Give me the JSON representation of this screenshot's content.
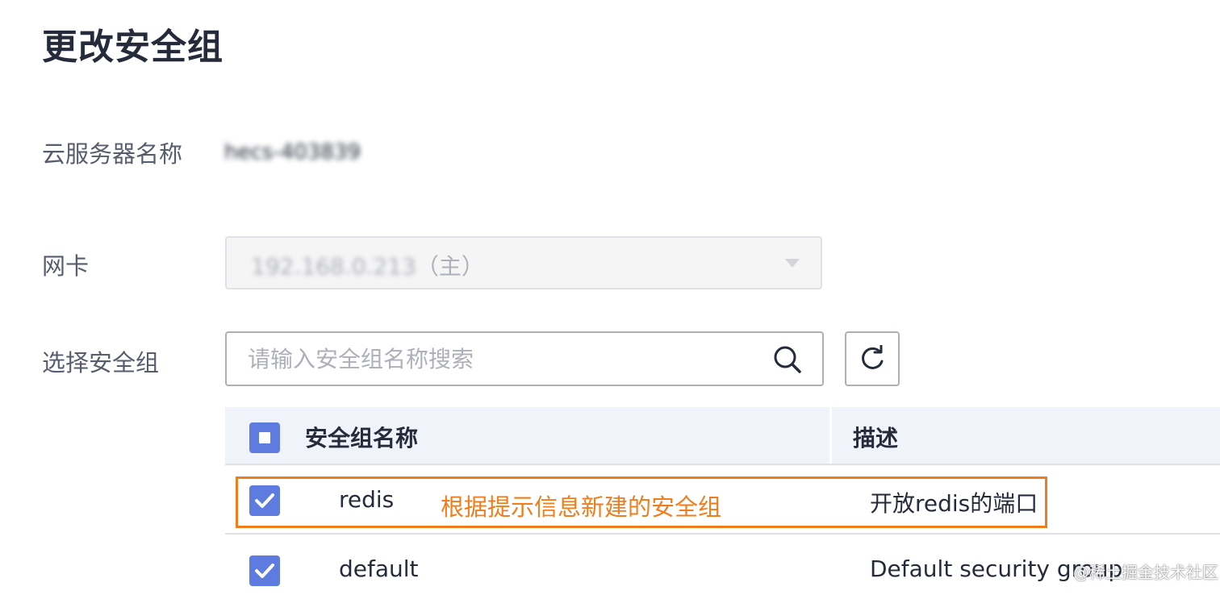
{
  "page": {
    "title": "更改安全组"
  },
  "form": {
    "server_name_label": "云服务器名称",
    "server_name_value": "hecs-403839",
    "nic_label": "网卡",
    "nic_ip": "192.168.0.213",
    "nic_suffix": "（主）",
    "security_group_label": "选择安全组",
    "search_placeholder": "请输入安全组名称搜索"
  },
  "table": {
    "columns": [
      "安全组名称",
      "描述"
    ],
    "rows": [
      {
        "name": "redis",
        "description": "开放redis的端口",
        "checked": true
      },
      {
        "name": "default",
        "description": "Default security group",
        "checked": true
      }
    ]
  },
  "annotation": {
    "text": "根据提示信息新建的安全组",
    "color": "#f07d1b"
  },
  "watermark": "@稀土掘金技术社区",
  "colors": {
    "accent": "#5e7ce0",
    "header_bg": "#f0f3f9",
    "annotation": "#f07d1b"
  },
  "icons": [
    "search-icon",
    "refresh-icon",
    "checkbox-check-icon",
    "select-caret-icon"
  ]
}
